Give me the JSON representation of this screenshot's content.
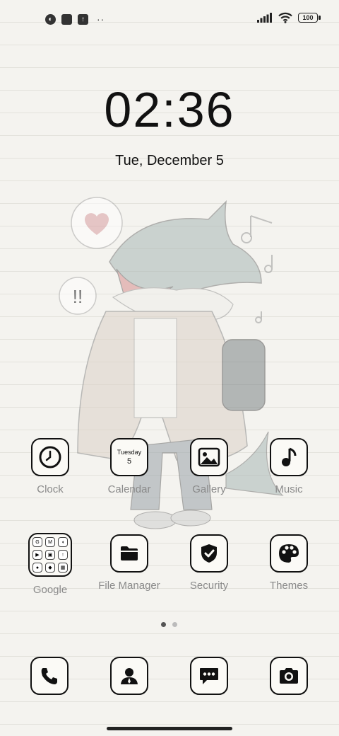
{
  "status_bar": {
    "battery_level": "100",
    "notification_icons": [
      "eye-circle-icon",
      "square-app-icon",
      "upload-icon"
    ],
    "more": "··"
  },
  "lock_clock": {
    "time": "02:36",
    "date": "Tue, December 5"
  },
  "apps_row1": [
    {
      "label": "Clock",
      "icon": "clock-icon"
    },
    {
      "label": "Calendar",
      "icon": "calendar-icon",
      "day": "Tuesday",
      "date": "5"
    },
    {
      "label": "Gallery",
      "icon": "gallery-icon"
    },
    {
      "label": "Music",
      "icon": "music-note-icon"
    }
  ],
  "apps_row2": [
    {
      "label": "Google",
      "icon": "google-folder-icon",
      "folder_glyphs": [
        "G",
        "M",
        "◖",
        "▶",
        "▣",
        "↑",
        "●",
        "◆",
        "▦"
      ]
    },
    {
      "label": "File Manager",
      "icon": "folder-icon"
    },
    {
      "label": "Security",
      "icon": "shield-check-icon"
    },
    {
      "label": "Themes",
      "icon": "palette-icon"
    }
  ],
  "page_indicator": {
    "pages": 2,
    "current": 1
  },
  "dock": [
    {
      "icon": "phone-icon"
    },
    {
      "icon": "contacts-icon"
    },
    {
      "icon": "messages-icon"
    },
    {
      "icon": "camera-icon"
    }
  ],
  "wallpaper": {
    "speech_marks": "!!"
  }
}
